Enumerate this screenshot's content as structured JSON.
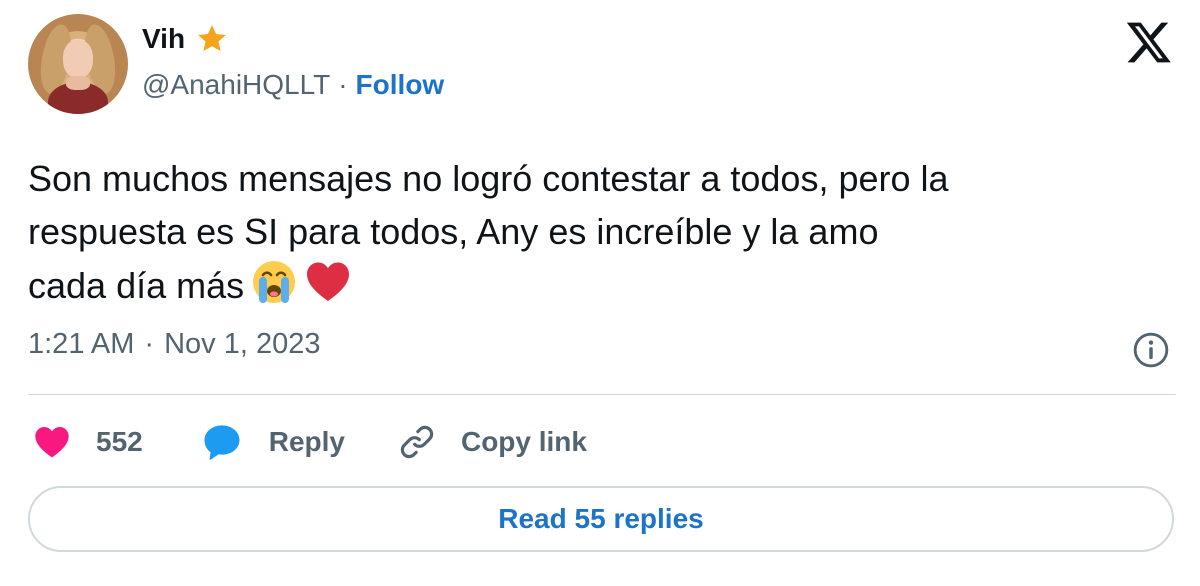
{
  "user": {
    "display_name": "Vih",
    "handle": "@AnahiHQLLT",
    "separator": "·",
    "follow_label": "Follow",
    "badge_icon": "star-icon"
  },
  "tweet": {
    "text": "Son muchos mensajes no logró contestar a todos, pero la\nrespuesta es SI para todos, Any es increíble y la amo\ncada día más",
    "emojis": [
      "loudly-crying-face-icon",
      "red-heart-icon"
    ],
    "time": "1:21 AM",
    "separator": "·",
    "date": "Nov 1, 2023"
  },
  "actions": {
    "like_count": "552",
    "reply_label": "Reply",
    "copy_link_label": "Copy link"
  },
  "footer": {
    "read_replies_label": "Read 55 replies"
  },
  "colors": {
    "link": "#1d73c9",
    "secondary_text": "#536471",
    "like": "#f91880",
    "reply_bubble": "#1d9bf0",
    "divider": "#cfd9de",
    "star": "#f4a51c"
  }
}
